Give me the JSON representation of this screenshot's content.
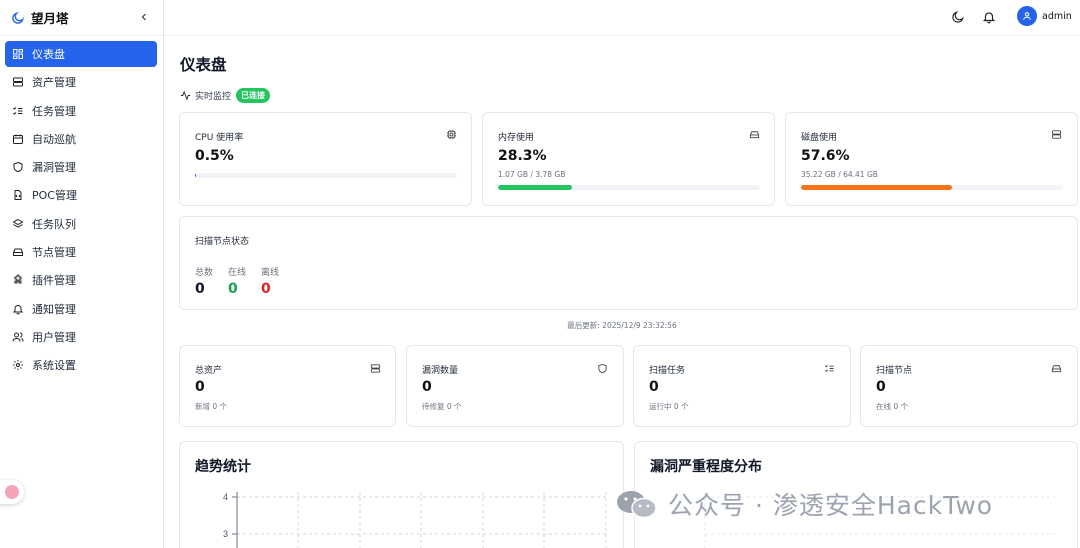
{
  "app": {
    "name": "望月塔"
  },
  "sidebar": {
    "items": [
      {
        "label": "仪表盘",
        "icon": "dashboard-icon",
        "active": true
      },
      {
        "label": "资产管理",
        "icon": "server-icon"
      },
      {
        "label": "任务管理",
        "icon": "list-checks-icon"
      },
      {
        "label": "自动巡航",
        "icon": "calendar-icon"
      },
      {
        "label": "漏洞管理",
        "icon": "shield-icon"
      },
      {
        "label": "POC管理",
        "icon": "file-code-icon"
      },
      {
        "label": "任务队列",
        "icon": "layers-icon"
      },
      {
        "label": "节点管理",
        "icon": "hard-drive-icon"
      },
      {
        "label": "插件管理",
        "icon": "puzzle-icon"
      },
      {
        "label": "通知管理",
        "icon": "bell-icon"
      },
      {
        "label": "用户管理",
        "icon": "users-icon"
      },
      {
        "label": "系统设置",
        "icon": "gear-icon"
      }
    ]
  },
  "header": {
    "username": "admin"
  },
  "page": {
    "title": "仪表盘",
    "live_label": "实时监控",
    "live_status": "已连接",
    "updated": "最后更新: 2025/12/9 23:32:56"
  },
  "resources": {
    "cpu": {
      "label": "CPU 使用率",
      "value": "0.5%",
      "percent": 0.5
    },
    "memory": {
      "label": "内存使用",
      "value": "28.3%",
      "detail": "1.07 GB / 3.78 GB",
      "percent": 28.3
    },
    "disk": {
      "label": "磁盘使用",
      "value": "57.6%",
      "detail": "35.22 GB / 64.41 GB",
      "percent": 57.6
    }
  },
  "nodes_status": {
    "title": "扫描节点状态",
    "total_label": "总数",
    "total": "0",
    "online_label": "在线",
    "online": "0",
    "offline_label": "离线",
    "offline": "0"
  },
  "summary": [
    {
      "label": "总资产",
      "value": "0",
      "sub": "新增 0 个",
      "icon": "server-icon"
    },
    {
      "label": "漏洞数量",
      "value": "0",
      "sub": "待修复 0 个",
      "icon": "shield-icon"
    },
    {
      "label": "扫描任务",
      "value": "0",
      "sub": "运行中 0 个",
      "icon": "list-checks-icon"
    },
    {
      "label": "扫描节点",
      "value": "0",
      "sub": "在线 0 个",
      "icon": "hard-drive-icon"
    }
  ],
  "trend": {
    "title": "趋势统计",
    "y_ticks": [
      "4",
      "3"
    ]
  },
  "severity": {
    "title": "漏洞严重程度分布"
  },
  "watermark": "公众号 · 渗透安全HackTwo",
  "colors": {
    "accent": "#2563eb",
    "success": "#22c55e",
    "danger": "#dc2626",
    "warning": "#f97316"
  }
}
